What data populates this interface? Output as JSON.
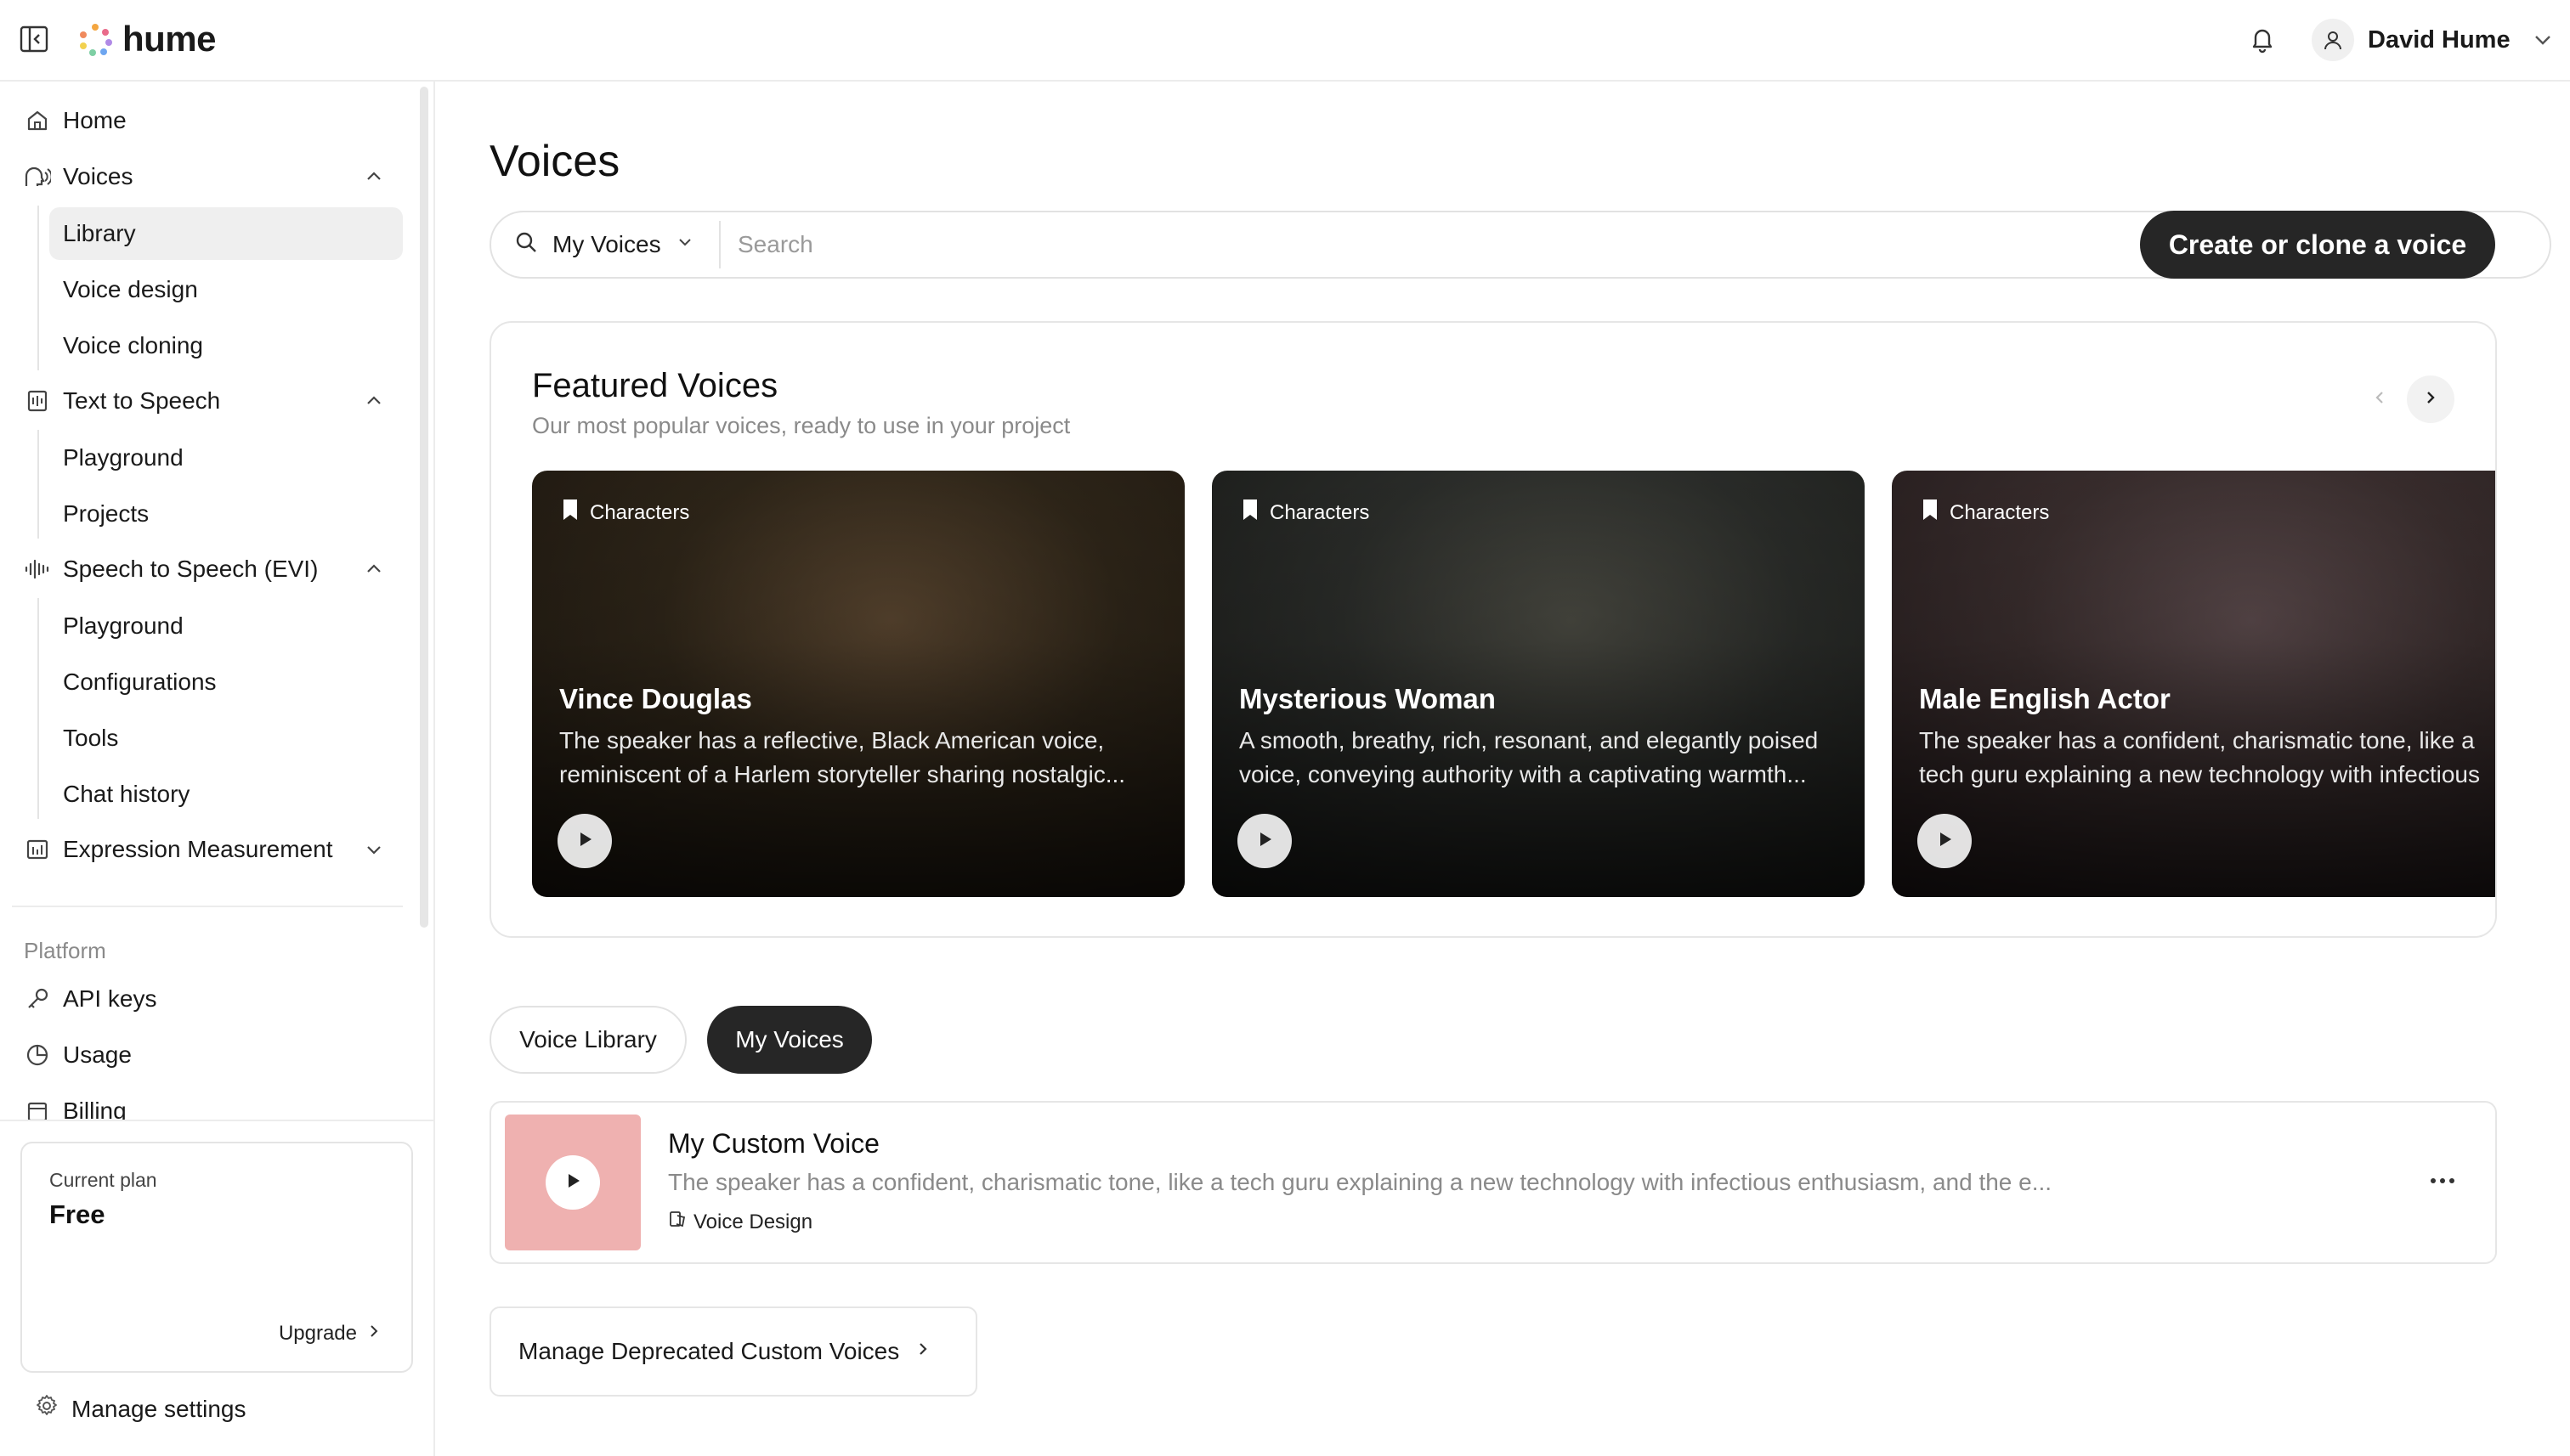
{
  "app": {
    "logo_text": "hume"
  },
  "header": {
    "user_name": "David Hume"
  },
  "sidebar": {
    "home": "Home",
    "voices": {
      "label": "Voices",
      "items": [
        "Library",
        "Voice design",
        "Voice cloning"
      ]
    },
    "tts": {
      "label": "Text to Speech",
      "items": [
        "Playground",
        "Projects"
      ]
    },
    "evi": {
      "label": "Speech to Speech (EVI)",
      "items": [
        "Playground",
        "Configurations",
        "Tools",
        "Chat history"
      ]
    },
    "expression": "Expression Measurement",
    "platform_label": "Platform",
    "platform_items": [
      "API keys",
      "Usage",
      "Billing"
    ],
    "plan": {
      "label": "Current plan",
      "value": "Free",
      "upgrade": "Upgrade"
    },
    "manage_settings": "Manage settings"
  },
  "main": {
    "title": "Voices",
    "search": {
      "filter": "My Voices",
      "placeholder": "Search"
    },
    "create_button": "Create or clone a voice",
    "featured": {
      "title": "Featured Voices",
      "subtitle": "Our most popular voices, ready to use in your project",
      "cards": [
        {
          "tag": "Characters",
          "name": "Vince Douglas",
          "description": "The speaker has a reflective, Black American voice, reminiscent of a Harlem storyteller sharing nostalgic...",
          "colors": [
            "#2f2619",
            "#5a4630",
            "#1d1710"
          ]
        },
        {
          "tag": "Characters",
          "name": "Mysterious Woman",
          "description": "A smooth, breathy, rich, resonant, and elegantly poised voice, conveying authority with a captivating warmth...",
          "colors": [
            "#2b2d2a",
            "#4a4a42",
            "#1a1b19"
          ]
        },
        {
          "tag": "Characters",
          "name": "Male English Actor",
          "description": "The speaker has a confident, charismatic tone, like a tech guru explaining a new technology with infectious",
          "colors": [
            "#3a2e2e",
            "#5b4a4c",
            "#241b1c"
          ]
        }
      ]
    },
    "tabs": {
      "library": "Voice Library",
      "my_voices": "My Voices"
    },
    "custom_voice": {
      "name": "My Custom Voice",
      "description": "The speaker has a confident, charismatic tone, like a tech guru explaining a new technology with infectious enthusiasm, and the e...",
      "type": "Voice Design"
    },
    "manage_deprecated": "Manage Deprecated Custom Voices"
  }
}
